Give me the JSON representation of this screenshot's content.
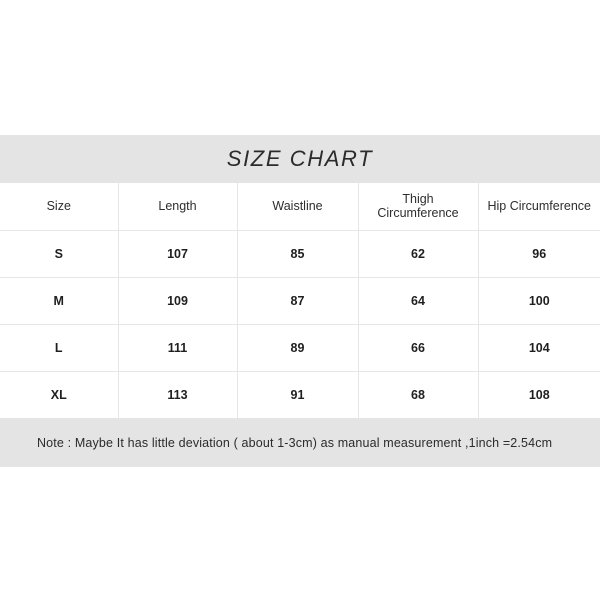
{
  "chart": {
    "title": "SIZE CHART",
    "note": "Note : Maybe It has little deviation ( about 1-3cm) as manual measurement ,1inch =2.54cm",
    "colors": {
      "band_background": "#e4e4e4",
      "table_background": "#ffffff",
      "grid_line": "#e6e6e6",
      "text": "#262626",
      "page_background": "#ffffff"
    },
    "columns": [
      "Size",
      "Length",
      "Waistline",
      "Thigh Circumference",
      "Hip Circumference"
    ],
    "rows": [
      {
        "size": "S",
        "length": "107",
        "waistline": "85",
        "thigh": "62",
        "hip": "96"
      },
      {
        "size": "M",
        "length": "109",
        "waistline": "87",
        "thigh": "64",
        "hip": "100"
      },
      {
        "size": "L",
        "length": "111",
        "waistline": "89",
        "thigh": "66",
        "hip": "104"
      },
      {
        "size": "XL",
        "length": "113",
        "waistline": "91",
        "thigh": "68",
        "hip": "108"
      }
    ]
  },
  "chart_data": {
    "type": "table",
    "title": "SIZE CHART",
    "categories": [
      "S",
      "M",
      "L",
      "XL"
    ],
    "columns": [
      "Size",
      "Length",
      "Waistline",
      "Thigh Circumference",
      "Hip Circumference"
    ],
    "series": [
      {
        "name": "Length",
        "values": [
          107,
          109,
          111,
          113
        ]
      },
      {
        "name": "Waistline",
        "values": [
          85,
          87,
          89,
          91
        ]
      },
      {
        "name": "Thigh Circumference",
        "values": [
          62,
          64,
          66,
          68
        ]
      },
      {
        "name": "Hip Circumference",
        "values": [
          96,
          100,
          104,
          108
        ]
      }
    ],
    "unit": "cm",
    "annotations": [
      "Note : Maybe It has little deviation ( about 1-3cm) as manual measurement ,1inch =2.54cm"
    ]
  }
}
